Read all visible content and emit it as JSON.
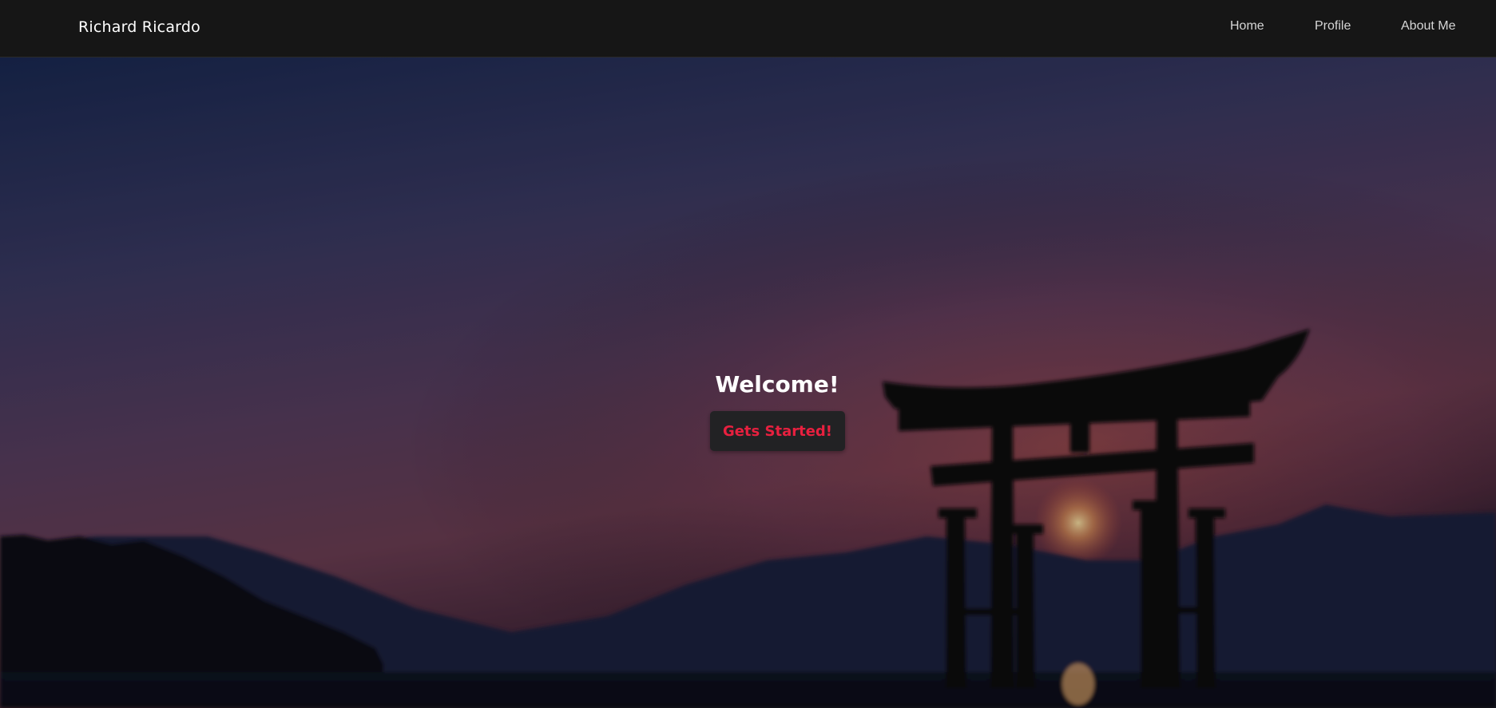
{
  "navbar": {
    "brand": "Richard Ricardo",
    "links": [
      {
        "label": "Home"
      },
      {
        "label": "Profile"
      },
      {
        "label": "About Me"
      }
    ]
  },
  "hero": {
    "heading": "Welcome!",
    "button_label": "Gets Started!",
    "background_image": "torii-gate-sunset-icon"
  },
  "colors": {
    "navbar_bg": "#161616",
    "button_bg": "#222224",
    "button_text": "#e8203f",
    "text": "#ffffff"
  }
}
